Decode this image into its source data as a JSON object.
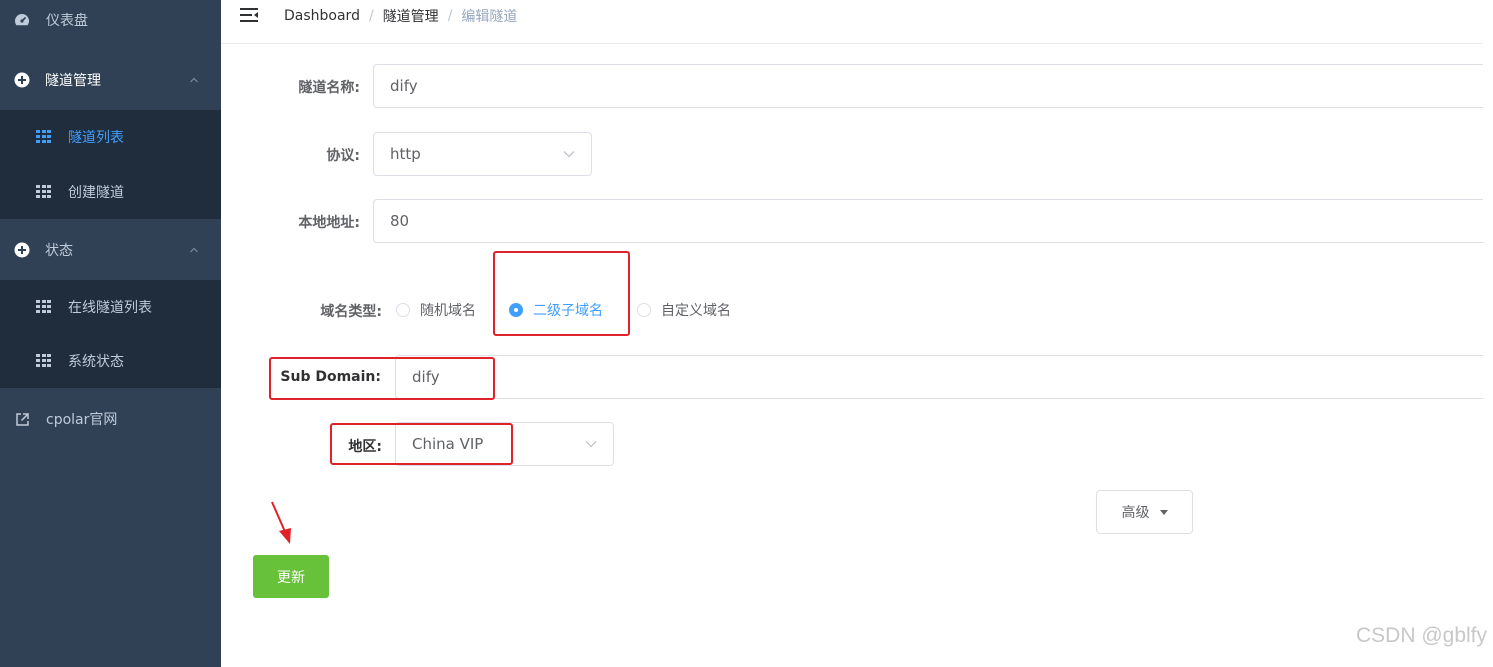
{
  "sidebar": {
    "dashboard": {
      "label": "仪表盘",
      "icon": "gauge-icon"
    },
    "tunnel_mgmt": {
      "label": "隧道管理",
      "icon": "circle-plus-icon",
      "items": [
        {
          "label": "隧道列表",
          "icon": "grid-icon",
          "active": true
        },
        {
          "label": "创建隧道",
          "icon": "grid-icon",
          "active": false
        }
      ]
    },
    "status": {
      "label": "状态",
      "icon": "circle-plus-icon",
      "items": [
        {
          "label": "在线隧道列表",
          "icon": "grid-icon"
        },
        {
          "label": "系统状态",
          "icon": "grid-icon"
        }
      ]
    },
    "cpolar_site": {
      "label": "cpolar官网",
      "icon": "external-link-icon"
    }
  },
  "header": {
    "breadcrumb": [
      "Dashboard",
      "隧道管理",
      "编辑隧道"
    ],
    "separator": "/"
  },
  "form": {
    "tunnel_name": {
      "label": "隧道名称:",
      "value": "dify"
    },
    "protocol": {
      "label": "协议:",
      "value": "http"
    },
    "local_address": {
      "label": "本地地址:",
      "value": "80"
    },
    "domain_type": {
      "label": "域名类型:",
      "options": [
        "随机域名",
        "二级子域名",
        "自定义域名"
      ],
      "selected": "二级子域名"
    },
    "sub_domain": {
      "label": "Sub Domain:",
      "value": "dify"
    },
    "region": {
      "label": "地区:",
      "value": "China VIP"
    },
    "advanced_label": "高级",
    "update_label": "更新"
  },
  "colors": {
    "sidebar_bg": "#304156",
    "submenu_bg": "#1f2d3d",
    "accent": "#409eff",
    "success": "#67c23a",
    "annotation": "#e0232b"
  },
  "watermark": "CSDN @gblfy"
}
